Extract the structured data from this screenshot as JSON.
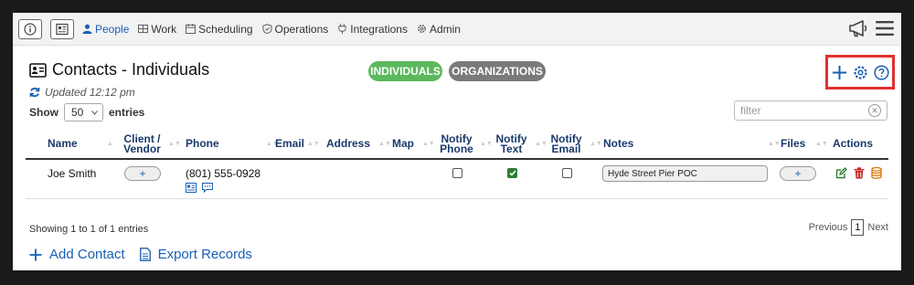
{
  "nav": {
    "items": [
      {
        "label": "People",
        "icon": "person-icon",
        "active": true
      },
      {
        "label": "Work",
        "icon": "work-icon",
        "active": false
      },
      {
        "label": "Scheduling",
        "icon": "calendar-icon",
        "active": false
      },
      {
        "label": "Operations",
        "icon": "shield-icon",
        "active": false
      },
      {
        "label": "Integrations",
        "icon": "plug-icon",
        "active": false
      },
      {
        "label": "Admin",
        "icon": "gear-icon",
        "active": false
      }
    ]
  },
  "header": {
    "title": "Contacts - Individuals",
    "updated": "Updated 12:12 pm",
    "tab_individuals": "INDIVIDUALS",
    "tab_organizations": "ORGANIZATIONS"
  },
  "controls": {
    "show_label": "Show",
    "entries_value": "50",
    "entries_label": "entries",
    "filter_placeholder": "filter"
  },
  "table": {
    "columns": [
      "Name",
      "Client / Vendor",
      "Phone",
      "Email",
      "Address",
      "Map",
      "Notify Phone",
      "Notify Text",
      "Notify Email",
      "Notes",
      "Files",
      "Actions"
    ],
    "rows": [
      {
        "name": "Joe Smith",
        "client_vendor": "+",
        "phone": "(801) 555-0928",
        "email": "",
        "address": "",
        "notify_phone": false,
        "notify_text": true,
        "notify_email": false,
        "notes": "Hyde Street Pier POC",
        "files": "+"
      }
    ]
  },
  "footer": {
    "showing": "Showing 1 to 1 of 1 entries",
    "previous": "Previous",
    "page": "1",
    "next": "Next",
    "add_contact": "Add Contact",
    "export_records": "Export Records"
  },
  "colors": {
    "accent": "#1a5fb4",
    "individuals": "#5cb85c",
    "organizations": "#7a7a7a",
    "highlight_box": "#e03030"
  }
}
